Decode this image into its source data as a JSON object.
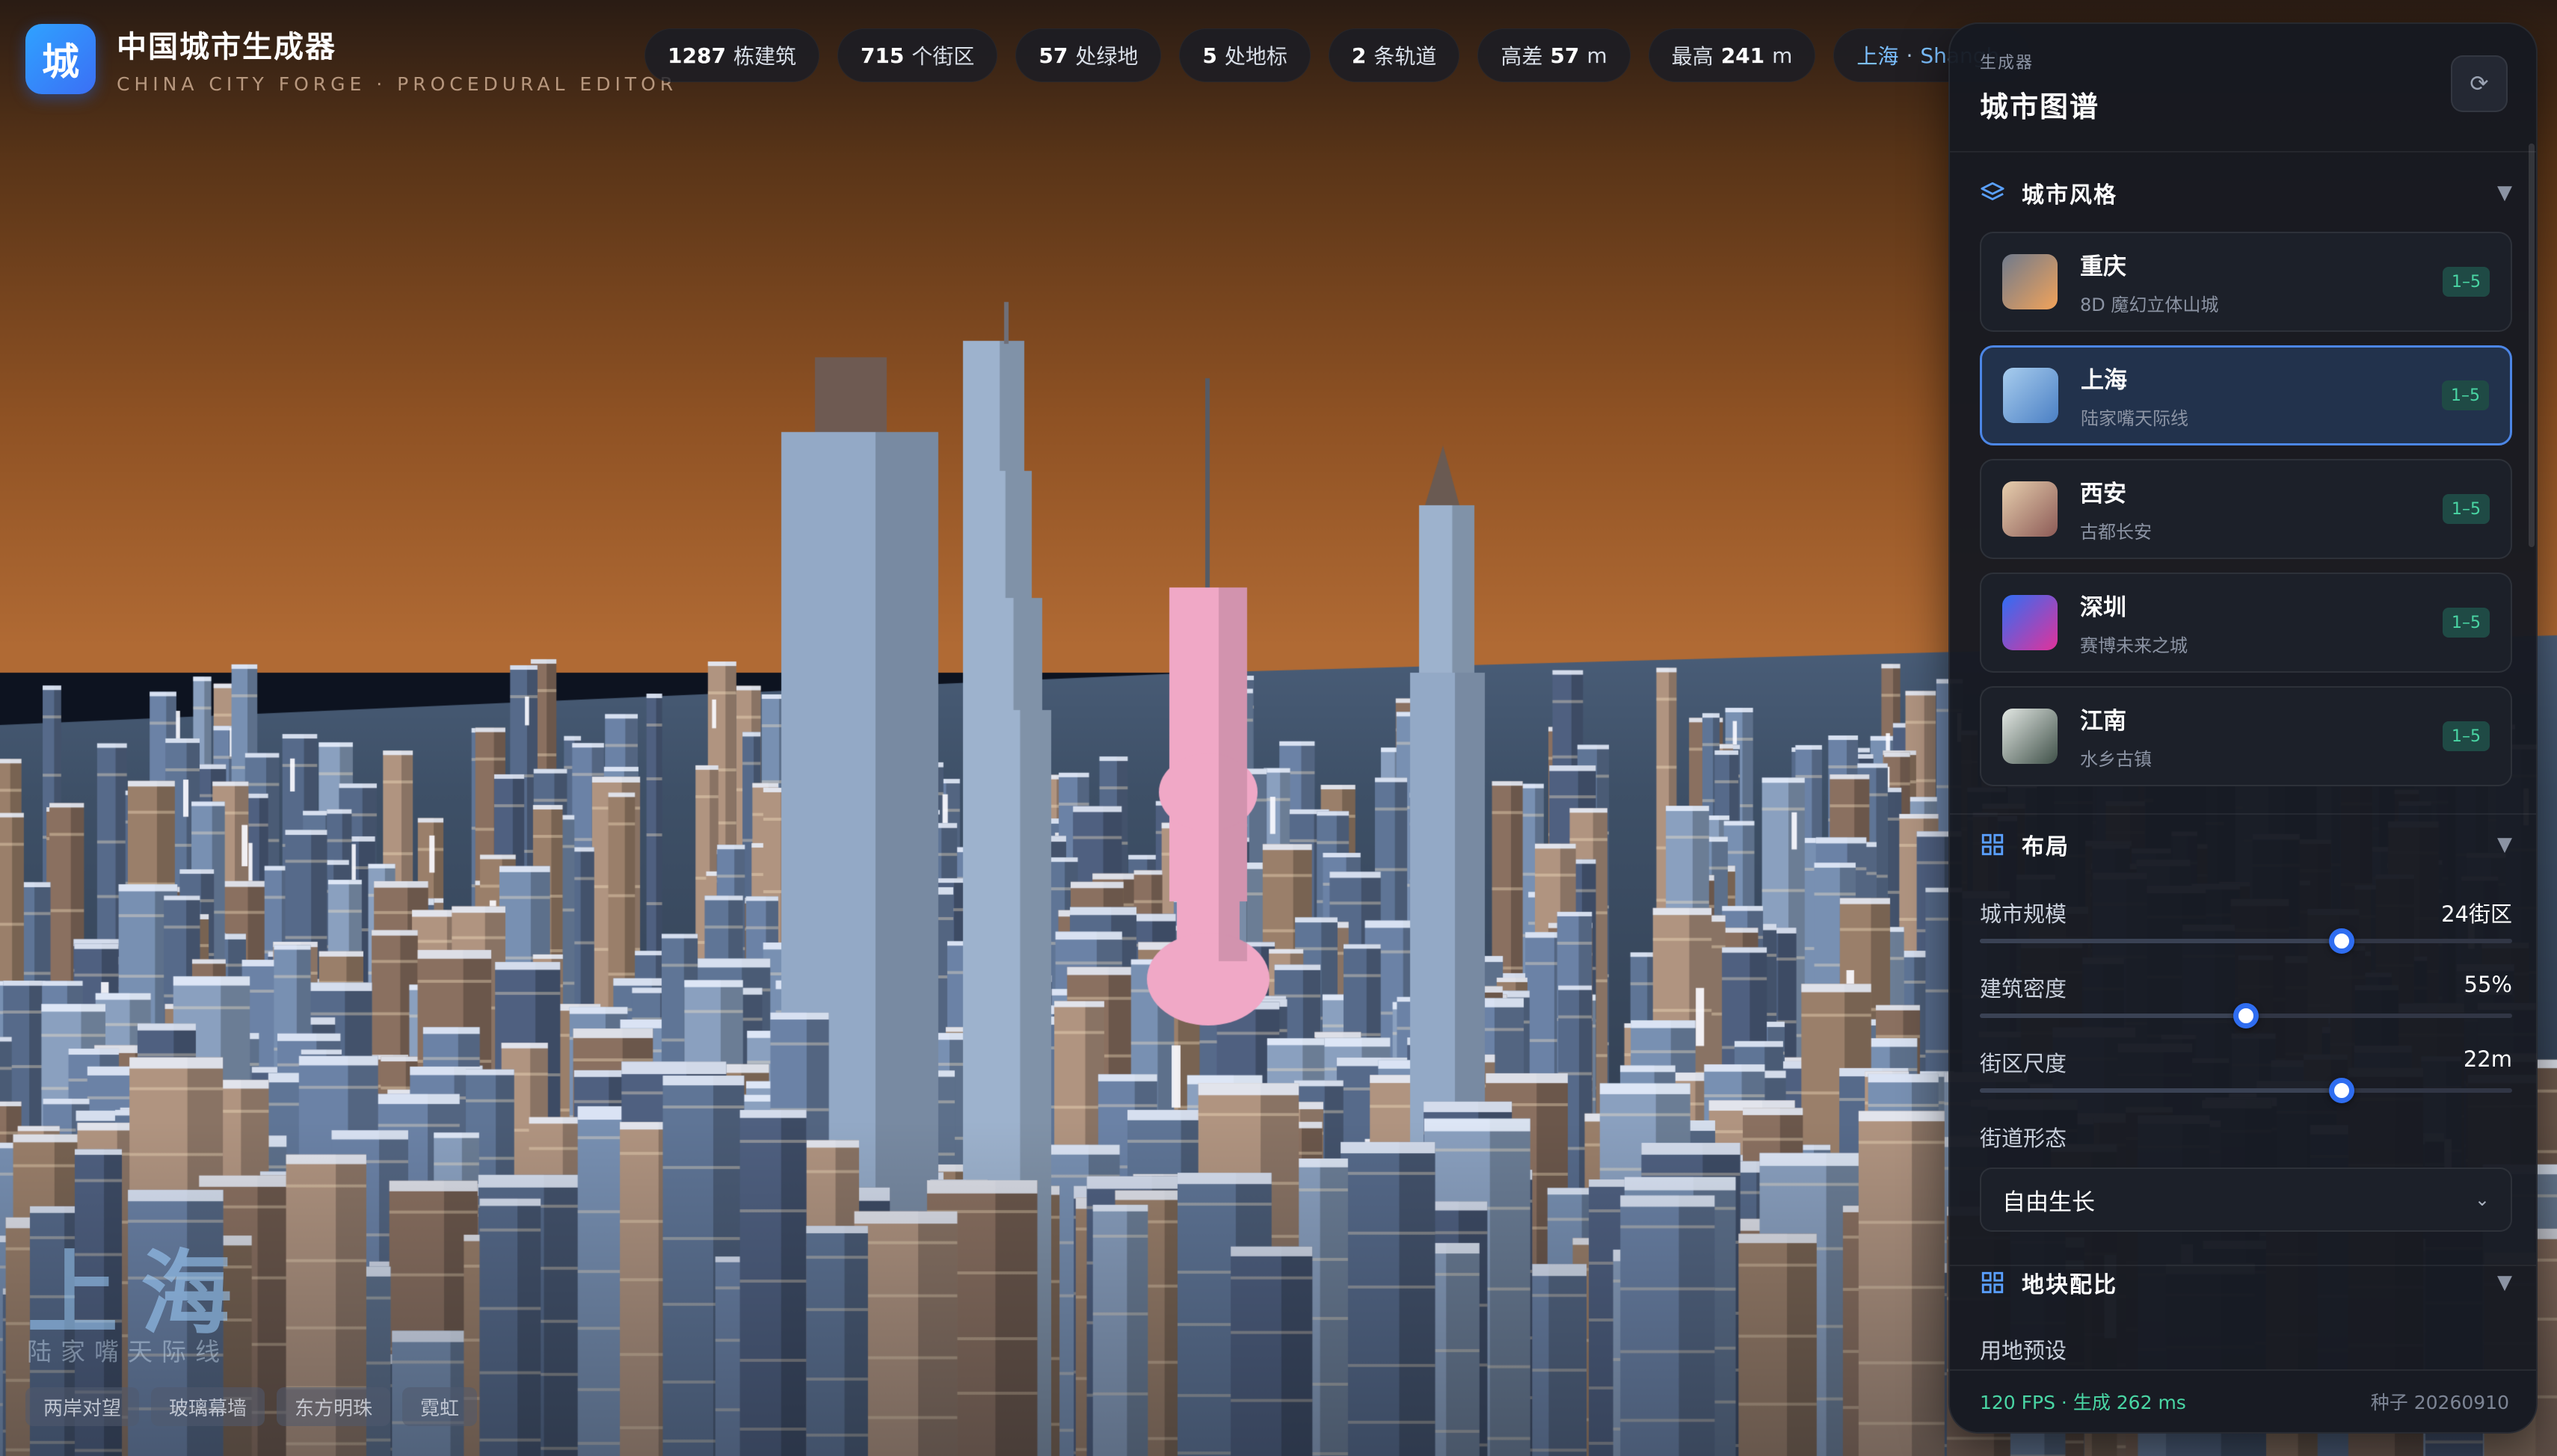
{
  "brand": {
    "logo_char": "城",
    "title": "中国城市生成器",
    "subtitle": "CHINA CITY FORGE · PROCEDURAL EDITOR"
  },
  "stats": [
    {
      "num": "1287",
      "unit": "栋建筑"
    },
    {
      "num": "715",
      "unit": "个街区"
    },
    {
      "num": "57",
      "unit": "处绿地"
    },
    {
      "num": "5",
      "unit": "处地标"
    },
    {
      "num": "2",
      "unit": "条轨道"
    },
    {
      "label": "高差",
      "num": "57",
      "unit": "m"
    },
    {
      "label": "最高",
      "num": "241",
      "unit": "m"
    }
  ],
  "city_chip": {
    "zh": "上海",
    "sep": "·",
    "en": "Shangh"
  },
  "overlay": {
    "city_big": "上海",
    "city_sub": "陆家嘴天际线",
    "tags": [
      "两岸对望",
      "玻璃幕墙",
      "东方明珠",
      "霓虹"
    ]
  },
  "panel": {
    "eyebrow": "生成器",
    "title": "城市图谱",
    "refresh_icon": "⟳",
    "style_section": {
      "title": "城市风格",
      "icon": "layers-icon",
      "styles": [
        {
          "name": "重庆",
          "desc": "8D 魔幻立体山城",
          "badge": "1–5",
          "colors": [
            "#6f7a8c",
            "#f2a35a"
          ]
        },
        {
          "name": "上海",
          "desc": "陆家嘴天际线",
          "badge": "1–5",
          "colors": [
            "#a8cdee",
            "#4a7fc4"
          ],
          "active": true
        },
        {
          "name": "西安",
          "desc": "古都长安",
          "badge": "1–5",
          "colors": [
            "#e7cfae",
            "#8c5a56"
          ]
        },
        {
          "name": "深圳",
          "desc": "赛博未来之城",
          "badge": "1–5",
          "colors": [
            "#2f6ef5",
            "#e2329a"
          ]
        },
        {
          "name": "江南",
          "desc": "水乡古镇",
          "badge": "1–5",
          "colors": [
            "#e3e8e4",
            "#3f5048"
          ]
        }
      ]
    },
    "layout_section": {
      "title": "布局",
      "icon": "grid-icon",
      "sliders": [
        {
          "label": "城市规模",
          "value": "24街区",
          "fraction": 0.68
        },
        {
          "label": "建筑密度",
          "value": "55%",
          "fraction": 0.5
        },
        {
          "label": "街区尺度",
          "value": "22m",
          "fraction": 0.68
        }
      ],
      "street_label": "街道形态",
      "street_value": "自由生长"
    },
    "land_section": {
      "title": "地块配比",
      "icon": "grid-icon",
      "preset_label": "用地预设"
    },
    "footer": {
      "perf": "120 FPS · 生成 262 ms",
      "seed": "种子 20260910"
    }
  },
  "colors": {
    "accent": "#2f6df0",
    "badge_text": "#49d6a4",
    "tower_pink": "#f0a8c6"
  }
}
